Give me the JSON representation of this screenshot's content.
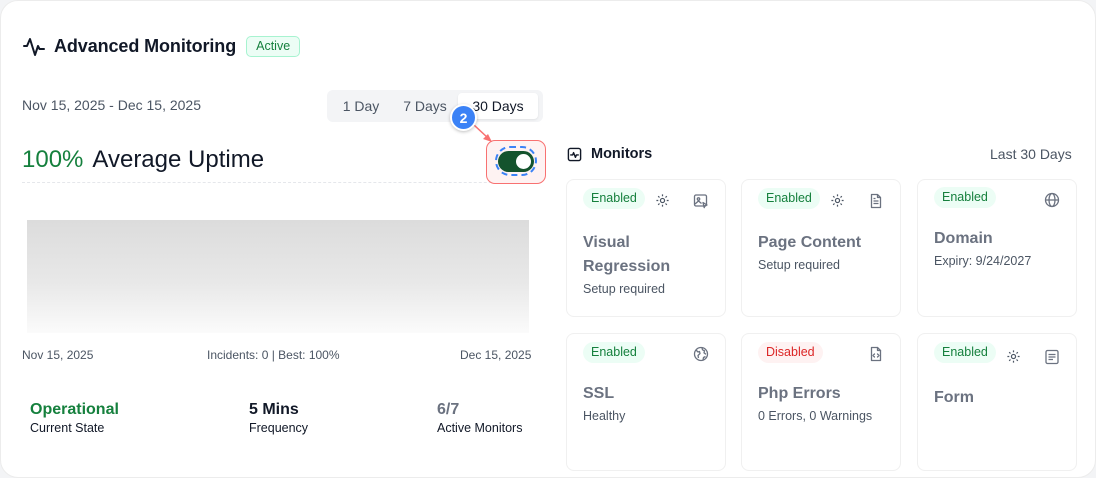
{
  "header": {
    "title": "Advanced Monitoring",
    "status_badge": "Active"
  },
  "date_range": "Nov 15, 2025 - Dec 15, 2025",
  "range_tabs": [
    {
      "label": "1 Day",
      "selected": false
    },
    {
      "label": "7 Days",
      "selected": false
    },
    {
      "label": "30 Days",
      "selected": true
    }
  ],
  "uptime": {
    "percent": "100%",
    "label": "Average Uptime"
  },
  "toggle": {
    "on": true
  },
  "annotation": {
    "step": "2"
  },
  "chart": {
    "start_date": "Nov 15, 2025",
    "summary": "Incidents: 0 | Best: 100%",
    "end_date": "Dec 15, 2025"
  },
  "stats": [
    {
      "value": "Operational",
      "label": "Current State"
    },
    {
      "value": "5 Mins",
      "label": "Frequency"
    },
    {
      "value": "6/7",
      "label": "Active Monitors"
    }
  ],
  "monitors": {
    "title": "Monitors",
    "range": "Last 30 Days",
    "items": [
      {
        "status": "Enabled",
        "name_line1": "Visual",
        "name_line2": "Regression",
        "detail": "Setup required",
        "icon": "visual-regression-icon",
        "has_settings": true
      },
      {
        "status": "Enabled",
        "name_line1": "Page Content",
        "detail": "Setup required",
        "icon": "document-icon",
        "has_settings": true
      },
      {
        "status": "Enabled",
        "name_line1": "Domain",
        "detail": "Expiry: 9/24/2027",
        "icon": "globe-icon",
        "has_settings": false
      },
      {
        "status": "Enabled",
        "name_line1": "SSL",
        "detail": "Healthy",
        "icon": "ssl-globe-icon",
        "has_settings": false
      },
      {
        "status": "Disabled",
        "name_line1": "Php Errors",
        "detail": "0 Errors, 0 Warnings",
        "icon": "code-file-icon",
        "has_settings": false
      },
      {
        "status": "Enabled",
        "name_line1": "Form",
        "detail": "",
        "icon": "form-icon",
        "has_settings": true
      }
    ]
  },
  "colors": {
    "accent_green": "#15803d",
    "toggle_on": "#14532d",
    "disabled_red": "#dc2626",
    "annotation_blue": "#3b82f6"
  }
}
